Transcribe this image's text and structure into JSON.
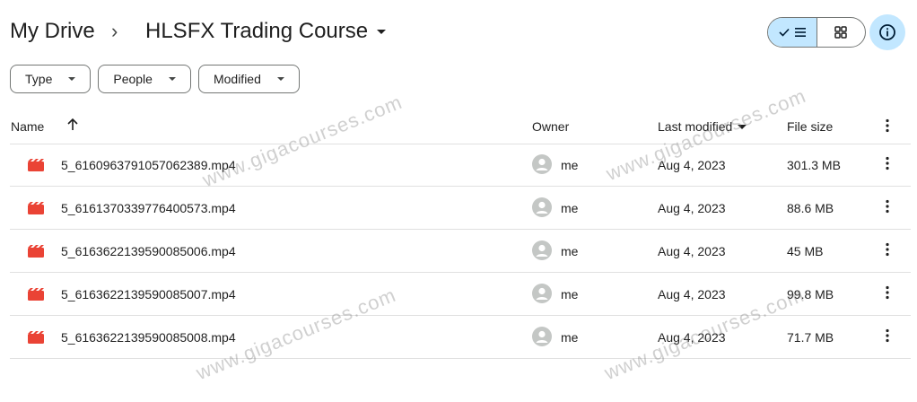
{
  "breadcrumb": {
    "root": "My Drive",
    "separator": "›",
    "current": "HLSFX Trading Course"
  },
  "view": {
    "active": "list"
  },
  "filters": [
    {
      "label": "Type"
    },
    {
      "label": "People"
    },
    {
      "label": "Modified"
    }
  ],
  "table": {
    "columns": {
      "name": "Name",
      "owner": "Owner",
      "last_modified": "Last modified",
      "file_size": "File size"
    },
    "rows": [
      {
        "name": "5_6160963791057062389.mp4",
        "owner": "me",
        "modified": "Aug 4, 2023",
        "size": "301.3 MB"
      },
      {
        "name": "5_6161370339776400573.mp4",
        "owner": "me",
        "modified": "Aug 4, 2023",
        "size": "88.6 MB"
      },
      {
        "name": "5_6163622139590085006.mp4",
        "owner": "me",
        "modified": "Aug 4, 2023",
        "size": "45 MB"
      },
      {
        "name": "5_6163622139590085007.mp4",
        "owner": "me",
        "modified": "Aug 4, 2023",
        "size": "99.8 MB"
      },
      {
        "name": "5_6163622139590085008.mp4",
        "owner": "me",
        "modified": "Aug 4, 2023",
        "size": "71.7 MB"
      }
    ]
  },
  "watermark": "www.gigacourses.com",
  "colors": {
    "accent": "#c2e7ff",
    "file_icon": "#ea4335"
  }
}
